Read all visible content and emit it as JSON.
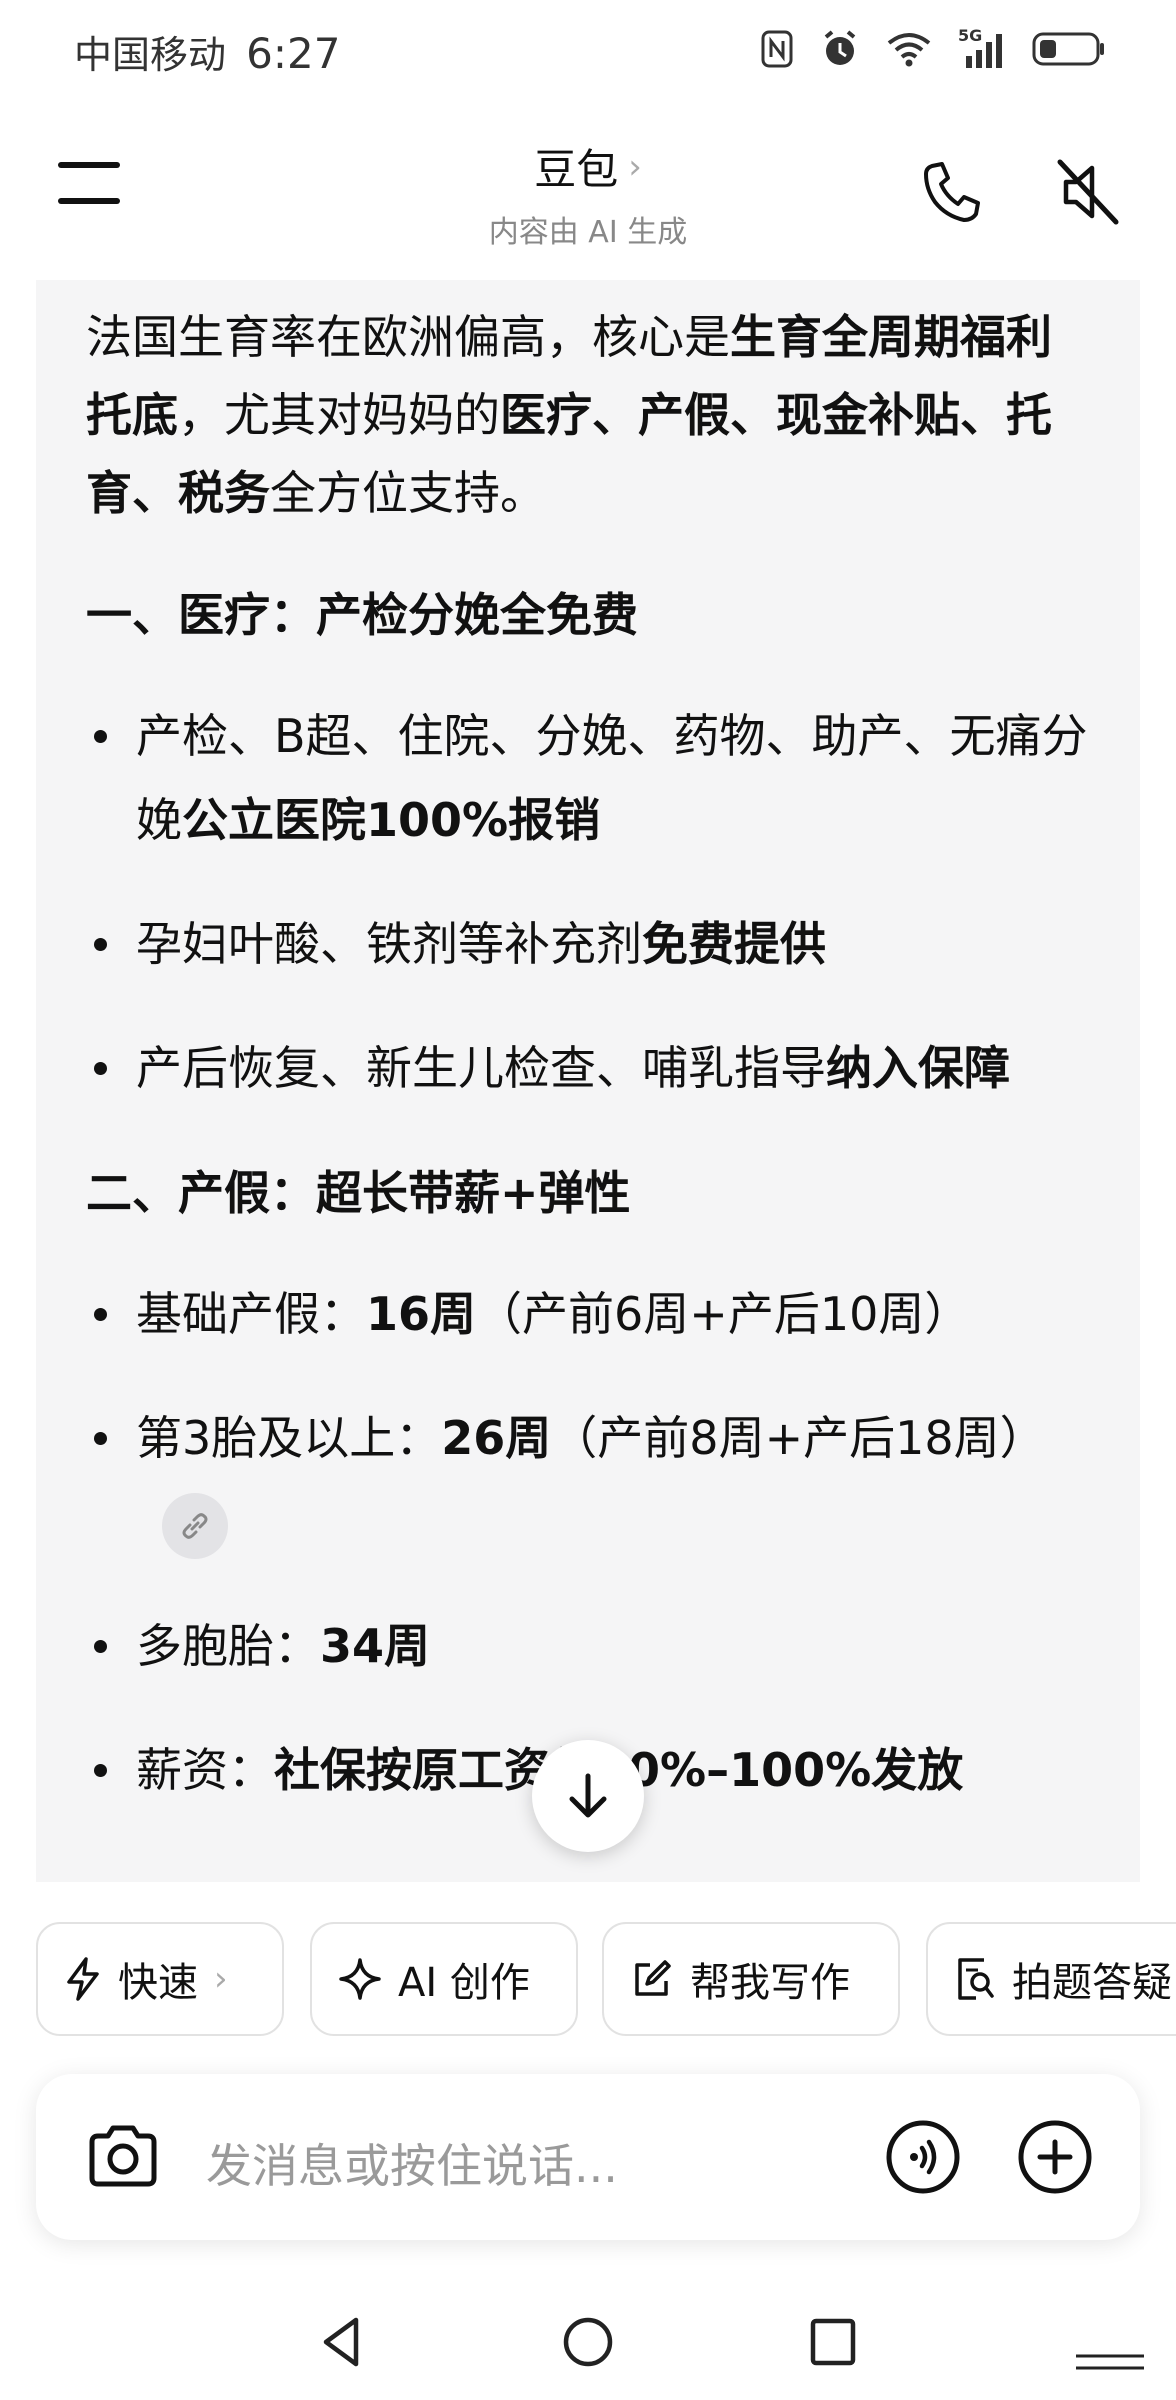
{
  "status_bar": {
    "carrier": "中国移动",
    "time": "6:27",
    "network": "5G"
  },
  "header": {
    "title": "豆包",
    "title_chevron": "›",
    "subtitle": "内容由 AI 生成"
  },
  "content": {
    "intro": {
      "t1": "法国生育率在欧洲偏高，核心是",
      "b1": "生育全周期福利托底",
      "t2": "，尤其对妈妈的",
      "b2": "医疗、产假、现金补贴、托育、税务",
      "t3": "全方位支持。"
    },
    "section1": {
      "heading": "一、医疗：产检分娩全免费",
      "items": [
        {
          "text": "产检、B超、住院、分娩、药物、助产、无痛分娩",
          "bold": "公立医院100%报销"
        },
        {
          "text": "孕妇叶酸、铁剂等补充剂",
          "bold": "免费提供"
        },
        {
          "text": "产后恢复、新生儿检查、哺乳指导",
          "bold": "纳入保障"
        }
      ]
    },
    "section2": {
      "heading": "二、产假：超长带薪+弹性",
      "items": [
        {
          "text": "基础产假：",
          "bold": "16周",
          "after": "（产前6周+产后10周）"
        },
        {
          "text": "第3胎及以上：",
          "bold": "26周",
          "after": "（产前8周+产后18周）"
        },
        {
          "text": "多胞胎：",
          "bold": "34周",
          "after": ""
        },
        {
          "text": "薪资：",
          "bold": "社保按原工资约90%–100%发放",
          "after": ""
        }
      ]
    }
  },
  "quick_actions": [
    {
      "label": "快速",
      "icon": "lightning-icon",
      "chevron": "›"
    },
    {
      "label": "AI 创作",
      "icon": "sparkle-icon"
    },
    {
      "label": "帮我写作",
      "icon": "edit-icon"
    },
    {
      "label": "拍题答疑",
      "icon": "scan-question-icon"
    }
  ],
  "input": {
    "placeholder": "发消息或按住说话..."
  },
  "icons": {
    "menu": "menu-icon",
    "phone": "phone-icon",
    "mute": "speaker-mute-icon",
    "scroll": "arrow-down-icon",
    "camera": "camera-icon",
    "voice": "voice-icon",
    "plus": "plus-icon"
  }
}
